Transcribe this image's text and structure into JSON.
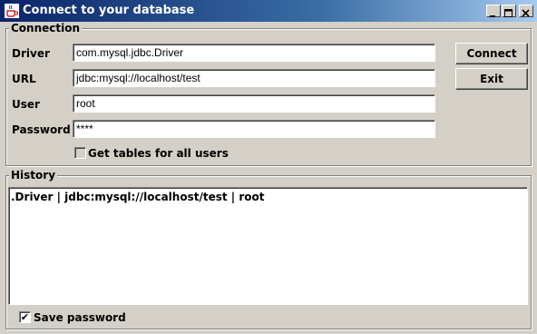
{
  "window": {
    "title": "Connect to your database",
    "icon": "java-coffee-cup-icon",
    "controls": {
      "minimize": "minimize-icon",
      "maximize": "maximize-icon",
      "close": "close-icon"
    }
  },
  "connection": {
    "legend": "Connection",
    "driver": {
      "label": "Driver",
      "value": "com.mysql.jdbc.Driver"
    },
    "url": {
      "label": "URL",
      "value": "jdbc:mysql://localhost/test"
    },
    "user": {
      "label": "User",
      "value": "root"
    },
    "password": {
      "label": "Password",
      "value": "****"
    },
    "all_users": {
      "label": "Get tables for all users",
      "checked": false
    },
    "connect_label": "Connect",
    "exit_label": "Exit"
  },
  "history": {
    "legend": "History",
    "entry": ".Driver | jdbc:mysql://localhost/test | root"
  },
  "save_password": {
    "label": "Save password",
    "checked": true,
    "mark": "✔"
  }
}
